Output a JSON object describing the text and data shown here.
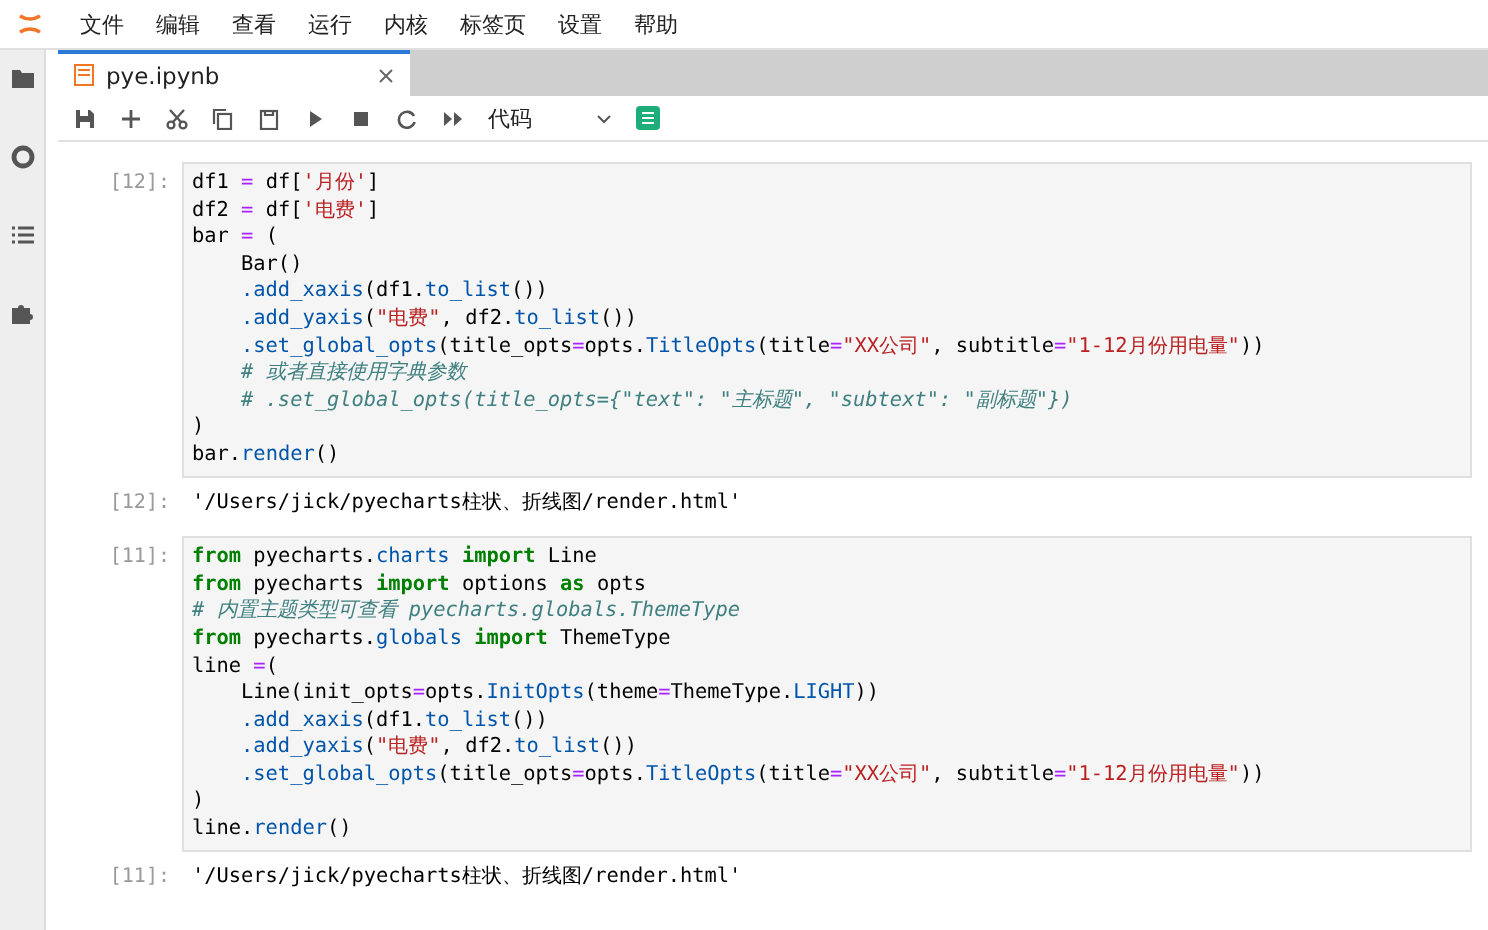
{
  "menu_bar": {
    "items": [
      "文件",
      "编辑",
      "查看",
      "运行",
      "内核",
      "标签页",
      "设置",
      "帮助"
    ]
  },
  "tabs": [
    {
      "label": "pye.ipynb",
      "selected": true
    }
  ],
  "toolbar": {
    "cell_type": "代码"
  },
  "cells": [
    {
      "prompt": "[12]:",
      "code": [
        [
          {
            "kind": "plain",
            "text": "df1 "
          },
          {
            "kind": "op",
            "text": "="
          },
          {
            "kind": "plain",
            "text": " df["
          },
          {
            "kind": "str",
            "text": "'月份'"
          },
          {
            "kind": "plain",
            "text": "]"
          }
        ],
        [
          {
            "kind": "plain",
            "text": "df2 "
          },
          {
            "kind": "op",
            "text": "="
          },
          {
            "kind": "plain",
            "text": " df["
          },
          {
            "kind": "str",
            "text": "'电费'"
          },
          {
            "kind": "plain",
            "text": "]"
          }
        ],
        [
          {
            "kind": "plain",
            "text": "bar "
          },
          {
            "kind": "op",
            "text": "="
          },
          {
            "kind": "plain",
            "text": " ("
          }
        ],
        [
          {
            "kind": "plain",
            "text": "    Bar()"
          }
        ],
        [
          {
            "kind": "prop",
            "text": "    .add_xaxis"
          },
          {
            "kind": "plain",
            "text": "(df1."
          },
          {
            "kind": "prop",
            "text": "to_list"
          },
          {
            "kind": "plain",
            "text": "())"
          }
        ],
        [
          {
            "kind": "prop",
            "text": "    .add_yaxis"
          },
          {
            "kind": "plain",
            "text": "("
          },
          {
            "kind": "str",
            "text": "\"电费\""
          },
          {
            "kind": "plain",
            "text": ", df2."
          },
          {
            "kind": "prop",
            "text": "to_list"
          },
          {
            "kind": "plain",
            "text": "())"
          }
        ],
        [
          {
            "kind": "prop",
            "text": "    .set_global_opts"
          },
          {
            "kind": "plain",
            "text": "(title_opts"
          },
          {
            "kind": "op",
            "text": "="
          },
          {
            "kind": "plain",
            "text": "opts."
          },
          {
            "kind": "prop",
            "text": "TitleOpts"
          },
          {
            "kind": "plain",
            "text": "(title"
          },
          {
            "kind": "op",
            "text": "="
          },
          {
            "kind": "str",
            "text": "\"XX公司\""
          },
          {
            "kind": "plain",
            "text": ", subtitle"
          },
          {
            "kind": "op",
            "text": "="
          },
          {
            "kind": "str",
            "text": "\"1-12月份用电量\""
          },
          {
            "kind": "plain",
            "text": "))"
          }
        ],
        [
          {
            "kind": "cm",
            "text": "    # 或者直接使用字典参数"
          }
        ],
        [
          {
            "kind": "cm",
            "text": "    # .set_global_opts(title_opts={\"text\": \"主标题\", \"subtext\": \"副标题\"})"
          }
        ],
        [
          {
            "kind": "plain",
            "text": ")"
          }
        ],
        [
          {
            "kind": "plain",
            "text": "bar."
          },
          {
            "kind": "prop",
            "text": "render"
          },
          {
            "kind": "plain",
            "text": "()"
          }
        ]
      ],
      "output": {
        "prompt": "[12]:",
        "text": "'/Users/jick/pyecharts柱状、折线图/render.html'"
      }
    },
    {
      "prompt": "[11]:",
      "code": [
        [
          {
            "kind": "kw",
            "text": "from"
          },
          {
            "kind": "plain",
            "text": " pyecharts."
          },
          {
            "kind": "prop",
            "text": "charts"
          },
          {
            "kind": "kw",
            "text": " import"
          },
          {
            "kind": "plain",
            "text": " Line"
          }
        ],
        [
          {
            "kind": "kw",
            "text": "from"
          },
          {
            "kind": "plain",
            "text": " pyecharts "
          },
          {
            "kind": "kw",
            "text": "import"
          },
          {
            "kind": "plain",
            "text": " options "
          },
          {
            "kind": "kw",
            "text": "as"
          },
          {
            "kind": "plain",
            "text": " opts"
          }
        ],
        [
          {
            "kind": "cm",
            "text": "# 内置主题类型可查看 pyecharts.globals.ThemeType"
          }
        ],
        [
          {
            "kind": "kw",
            "text": "from"
          },
          {
            "kind": "plain",
            "text": " pyecharts."
          },
          {
            "kind": "prop",
            "text": "globals"
          },
          {
            "kind": "kw",
            "text": " import"
          },
          {
            "kind": "plain",
            "text": " ThemeType"
          }
        ],
        [
          {
            "kind": "plain",
            "text": "line "
          },
          {
            "kind": "op",
            "text": "="
          },
          {
            "kind": "plain",
            "text": "("
          }
        ],
        [
          {
            "kind": "plain",
            "text": "    Line(init_opts"
          },
          {
            "kind": "op",
            "text": "="
          },
          {
            "kind": "plain",
            "text": "opts."
          },
          {
            "kind": "prop",
            "text": "InitOpts"
          },
          {
            "kind": "plain",
            "text": "(theme"
          },
          {
            "kind": "op",
            "text": "="
          },
          {
            "kind": "plain",
            "text": "ThemeType."
          },
          {
            "kind": "prop",
            "text": "LIGHT"
          },
          {
            "kind": "plain",
            "text": "))"
          }
        ],
        [
          {
            "kind": "prop",
            "text": "    .add_xaxis"
          },
          {
            "kind": "plain",
            "text": "(df1."
          },
          {
            "kind": "prop",
            "text": "to_list"
          },
          {
            "kind": "plain",
            "text": "())"
          }
        ],
        [
          {
            "kind": "prop",
            "text": "    .add_yaxis"
          },
          {
            "kind": "plain",
            "text": "("
          },
          {
            "kind": "str",
            "text": "\"电费\""
          },
          {
            "kind": "plain",
            "text": ", df2."
          },
          {
            "kind": "prop",
            "text": "to_list"
          },
          {
            "kind": "plain",
            "text": "())"
          }
        ],
        [
          {
            "kind": "prop",
            "text": "    .set_global_opts"
          },
          {
            "kind": "plain",
            "text": "(title_opts"
          },
          {
            "kind": "op",
            "text": "="
          },
          {
            "kind": "plain",
            "text": "opts."
          },
          {
            "kind": "prop",
            "text": "TitleOpts"
          },
          {
            "kind": "plain",
            "text": "(title"
          },
          {
            "kind": "op",
            "text": "="
          },
          {
            "kind": "str",
            "text": "\"XX公司\""
          },
          {
            "kind": "plain",
            "text": ", subtitle"
          },
          {
            "kind": "op",
            "text": "="
          },
          {
            "kind": "str",
            "text": "\"1-12月份用电量\""
          },
          {
            "kind": "plain",
            "text": "))"
          }
        ],
        [
          {
            "kind": "plain",
            "text": ")"
          }
        ],
        [
          {
            "kind": "plain",
            "text": "line."
          },
          {
            "kind": "prop",
            "text": "render"
          },
          {
            "kind": "plain",
            "text": "()"
          }
        ]
      ],
      "output": {
        "prompt": "[11]:",
        "text": "'/Users/jick/pyecharts柱状、折线图/render.html'"
      }
    }
  ]
}
